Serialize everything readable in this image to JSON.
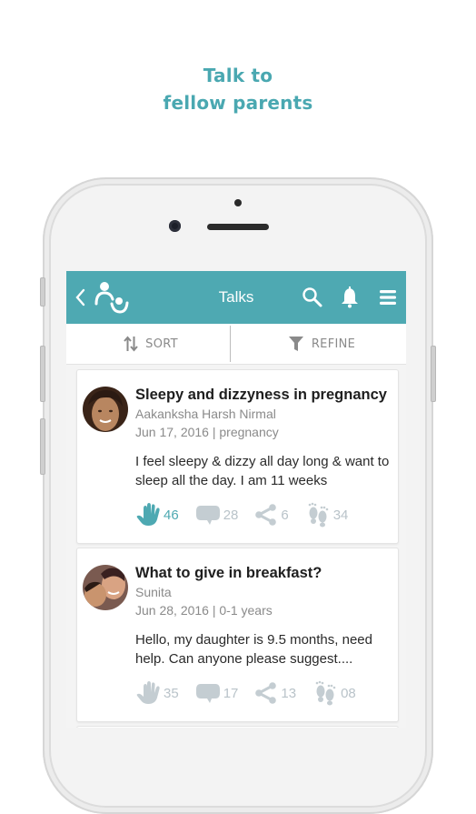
{
  "tagline": {
    "line1": "Talk to",
    "line2": "fellow parents"
  },
  "colors": {
    "accent": "#4ea9b2",
    "tagline": "#4aa8b1",
    "stat_inactive": "#b9c3c9"
  },
  "appbar": {
    "title": "Talks",
    "icons": [
      "back-icon",
      "parent-child-logo-icon",
      "search-icon",
      "bell-icon",
      "menu-icon"
    ]
  },
  "toolbar": {
    "sort_label": "SORT",
    "refine_label": "REFINE"
  },
  "posts": [
    {
      "title": "Sleepy and dizzyness in pregnancy",
      "author": "Aakanksha Harsh Nirmal",
      "meta": "Jun 17, 2016 | pregnancy",
      "body": "I feel sleepy & dizzy all day long & want to sleep all the day. I am 11 weeks",
      "stats": {
        "hi5": "46",
        "comments": "28",
        "shares": "6",
        "steps": "34"
      },
      "hi5_active": true
    },
    {
      "title": "What to give in breakfast?",
      "author": "Sunita",
      "meta": "Jun 28, 2016 | 0-1 years",
      "body": "Hello, my daughter is 9.5 months, need help. Can anyone please suggest....",
      "stats": {
        "hi5": "35",
        "comments": "17",
        "shares": "13",
        "steps": "08"
      },
      "hi5_active": false
    }
  ]
}
